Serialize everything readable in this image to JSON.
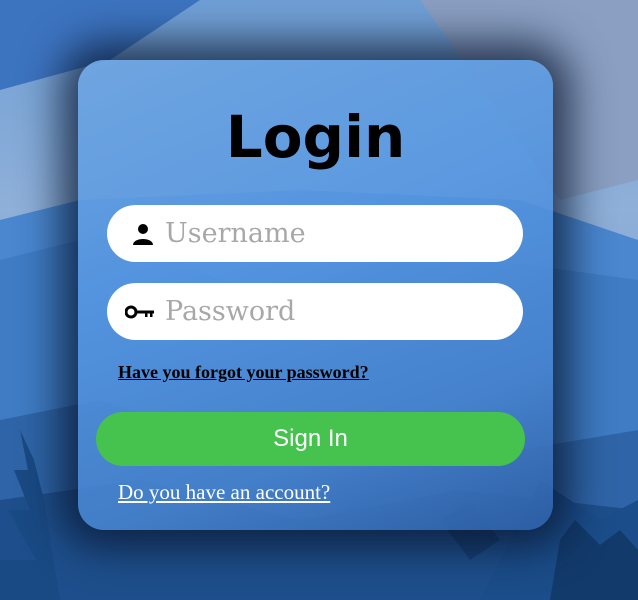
{
  "login": {
    "title": "Login",
    "username_placeholder": "Username",
    "password_placeholder": "Password",
    "forgot_link": "Have you forgot your password?",
    "sign_in_label": "Sign In",
    "account_link": "Do you have an account?"
  },
  "icons": {
    "username": "user-icon",
    "password": "key-icon"
  },
  "colors": {
    "sign_in_button": "#46c24e",
    "card": "#5a9be0"
  }
}
